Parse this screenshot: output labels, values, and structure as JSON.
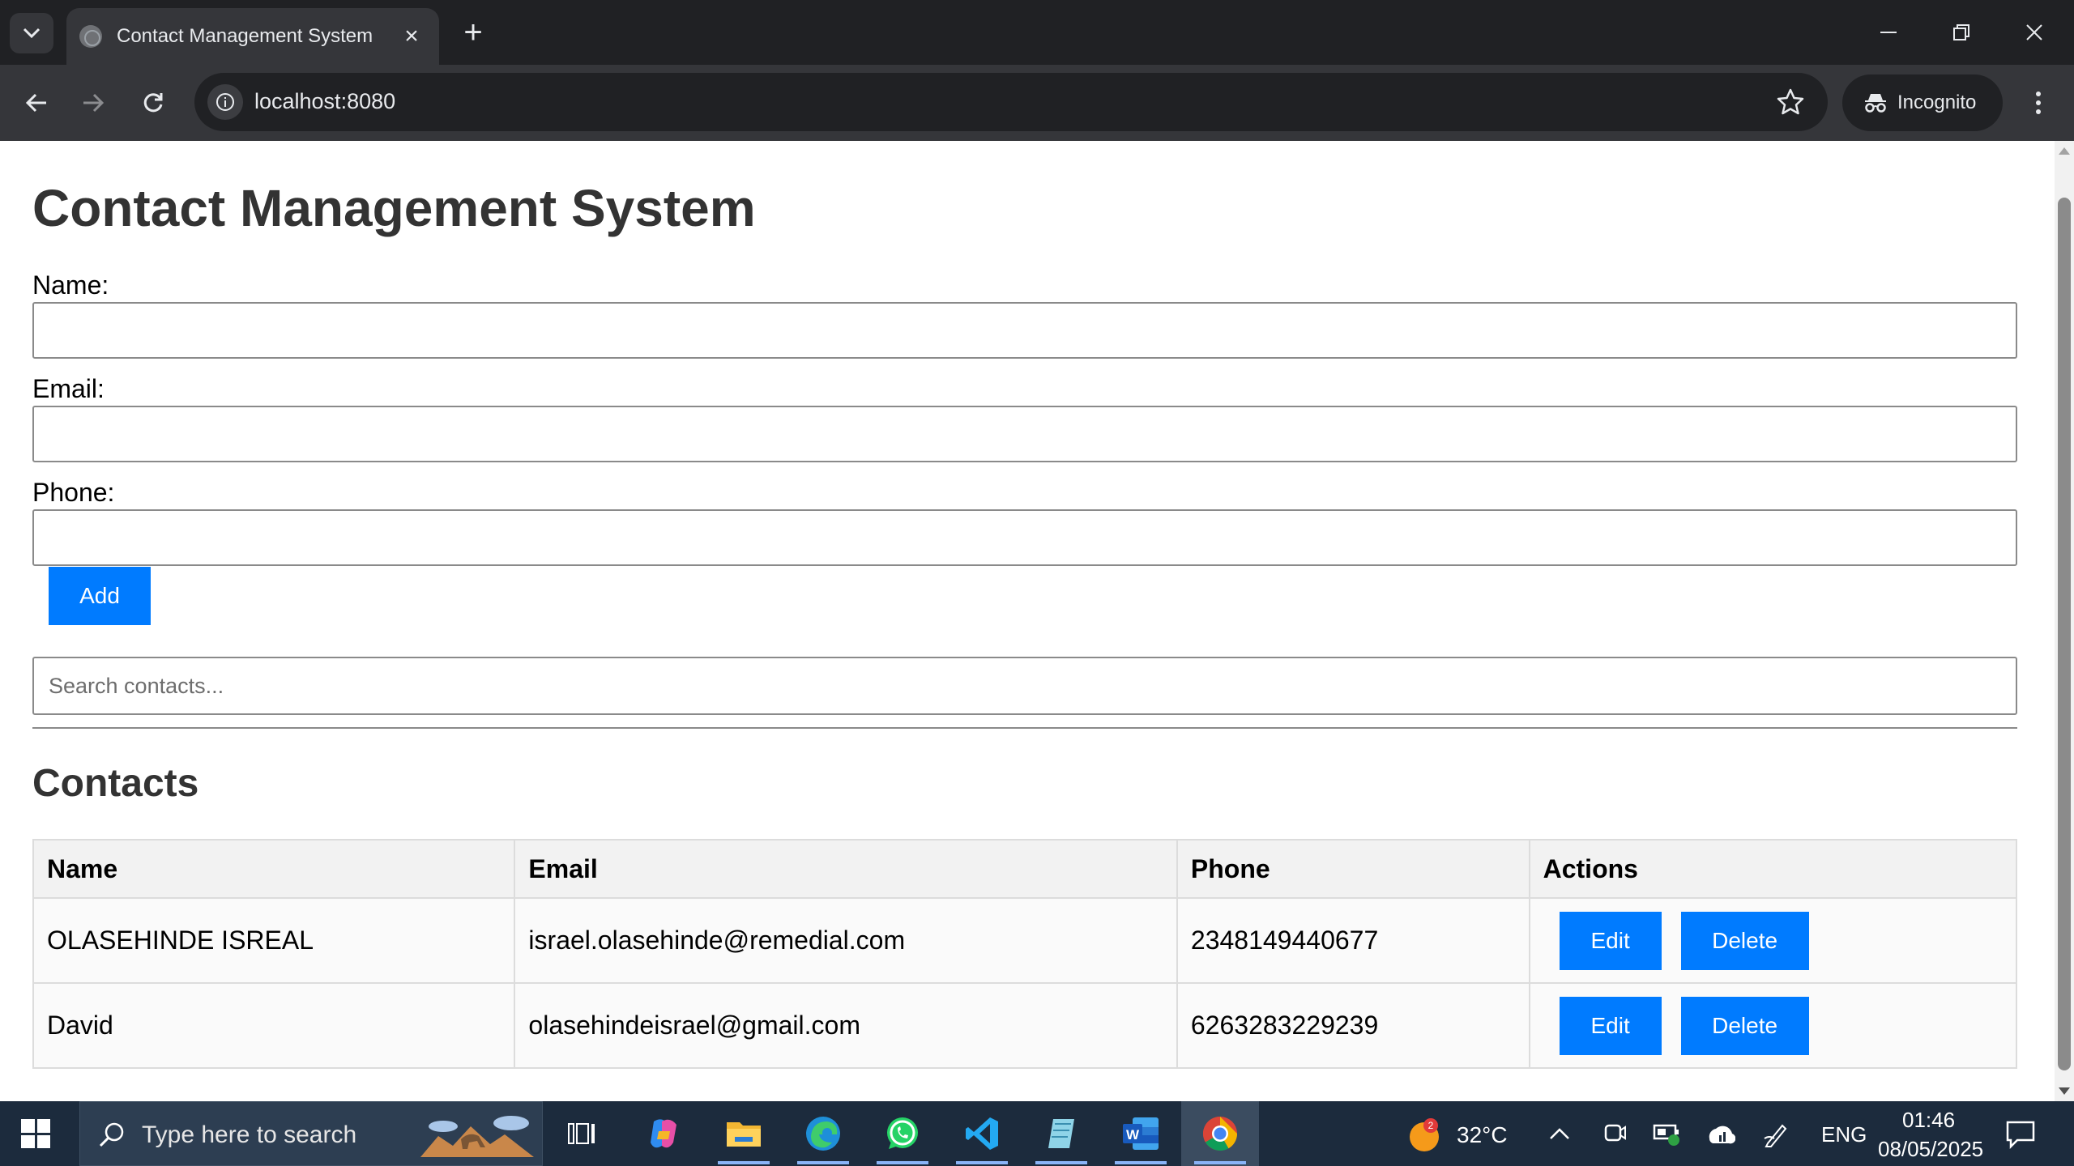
{
  "browser": {
    "tab_title": "Contact Management System",
    "url": "localhost:8080",
    "incognito_label": "Incognito"
  },
  "page": {
    "title": "Contact Management System",
    "form": {
      "name_label": "Name:",
      "name_value": "",
      "email_label": "Email:",
      "email_value": "",
      "phone_label": "Phone:",
      "phone_value": "",
      "add_label": "Add"
    },
    "search": {
      "placeholder": "Search contacts...",
      "value": ""
    },
    "contacts_heading": "Contacts",
    "table": {
      "headers": [
        "Name",
        "Email",
        "Phone",
        "Actions"
      ],
      "rows": [
        {
          "name": "OLASEHINDE ISREAL",
          "email": "israel.olasehinde@remedial.com",
          "phone": "2348149440677",
          "edit_label": "Edit",
          "delete_label": "Delete"
        },
        {
          "name": "David",
          "email": "olasehindeisrael@gmail.com",
          "phone": "6263283229239",
          "edit_label": "Edit",
          "delete_label": "Delete"
        }
      ]
    }
  },
  "taskbar": {
    "search_placeholder": "Type here to search",
    "weather_temp": "32°C",
    "weather_badge": "2",
    "language": "ENG",
    "time": "01:46",
    "date": "08/05/2025",
    "apps": [
      "task-view",
      "copilot",
      "file-explorer",
      "edge",
      "whatsapp",
      "vscode",
      "notepad",
      "word",
      "chrome"
    ]
  },
  "colors": {
    "primary_button": "#007bff",
    "chrome_dark": "#202124",
    "chrome_toolbar": "#35363a",
    "taskbar": "#1c2b3d"
  }
}
